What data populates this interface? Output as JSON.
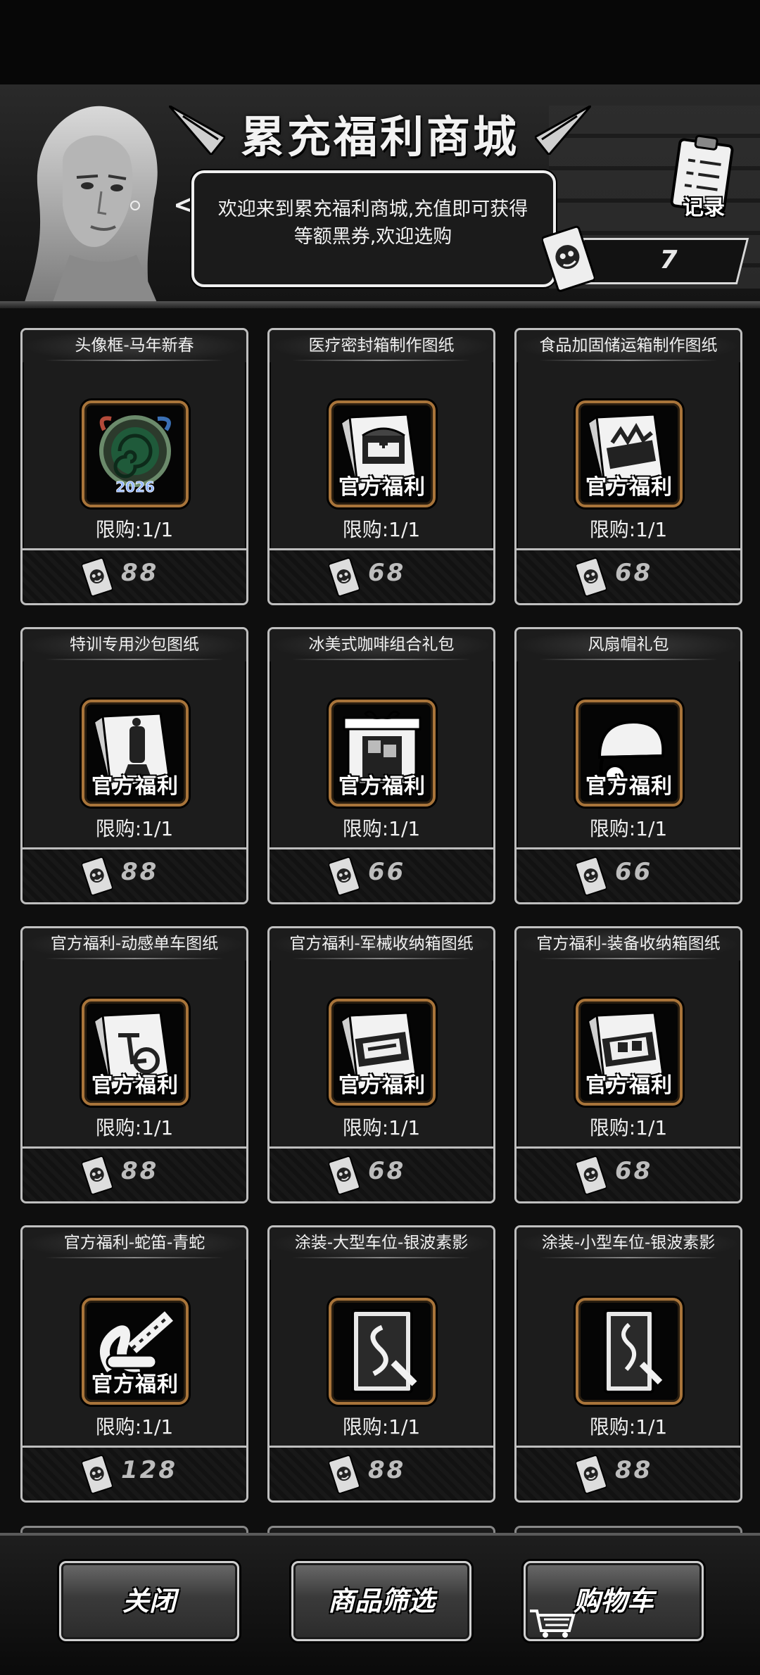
{
  "header": {
    "title": "累充福利商城",
    "welcome": "欢迎来到累充福利商城,充值即可获得等额黑券,欢迎选购",
    "record_label": "记录",
    "balance": "7"
  },
  "items": [
    {
      "title": "头像框-马年新春",
      "badge": "",
      "limit": "限购:1/1",
      "price": "88",
      "icon": "avatar-frame-2026"
    },
    {
      "title": "医疗密封箱制作图纸",
      "badge": "官方福利",
      "limit": "限购:1/1",
      "price": "68",
      "icon": "blueprint-medical-box"
    },
    {
      "title": "食品加固储运箱制作图纸",
      "badge": "官方福利",
      "limit": "限购:1/1",
      "price": "68",
      "icon": "blueprint-food-box"
    },
    {
      "title": "特训专用沙包图纸",
      "badge": "官方福利",
      "limit": "限购:1/1",
      "price": "88",
      "icon": "blueprint-sandbag"
    },
    {
      "title": "冰美式咖啡组合礼包",
      "badge": "官方福利",
      "limit": "限购:1/1",
      "price": "66",
      "icon": "gift-coffee"
    },
    {
      "title": "风扇帽礼包",
      "badge": "官方福利",
      "limit": "限购:1/1",
      "price": "66",
      "icon": "fan-cap"
    },
    {
      "title": "官方福利-动感单车图纸",
      "badge": "官方福利",
      "limit": "限购:1/1",
      "price": "88",
      "icon": "blueprint-bike"
    },
    {
      "title": "官方福利-军械收纳箱图纸",
      "badge": "官方福利",
      "limit": "限购:1/1",
      "price": "68",
      "icon": "blueprint-armory-box"
    },
    {
      "title": "官方福利-装备收纳箱图纸",
      "badge": "官方福利",
      "limit": "限购:1/1",
      "price": "68",
      "icon": "blueprint-gear-box"
    },
    {
      "title": "官方福利-蛇笛-青蛇",
      "badge": "官方福利",
      "limit": "限购:1/1",
      "price": "128",
      "icon": "snake-flute"
    },
    {
      "title": "涂装-大型车位-银波素影",
      "badge": "",
      "limit": "限购:1/1",
      "price": "88",
      "icon": "paint-large"
    },
    {
      "title": "涂装-小型车位-银波素影",
      "badge": "",
      "limit": "限购:1/1",
      "price": "88",
      "icon": "paint-small"
    }
  ],
  "footer": {
    "close_label": "关闭",
    "filter_label": "商品筛选",
    "cart_label": "购物车"
  },
  "colors": {
    "frame_gold": "#a8743a",
    "border": "#bfbfbf",
    "background": "#0e0e0e"
  }
}
